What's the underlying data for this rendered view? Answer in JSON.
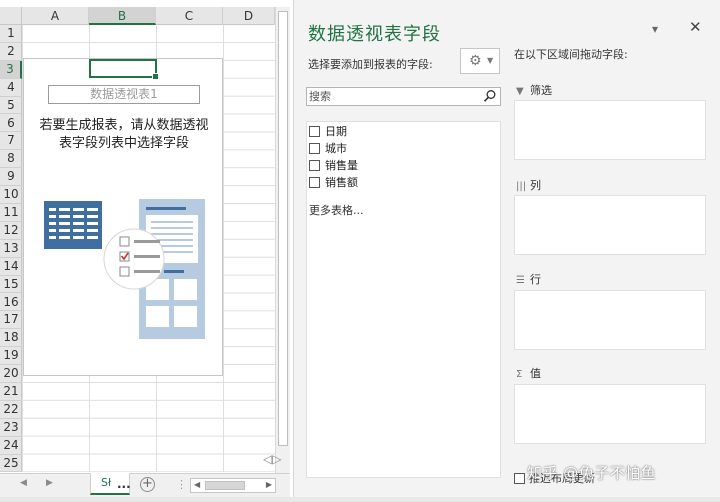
{
  "spreadsheet": {
    "columns": [
      "A",
      "B",
      "C",
      "D"
    ],
    "active_column": "B",
    "rows": [
      "1",
      "2",
      "3",
      "4",
      "5",
      "6",
      "7",
      "8",
      "9",
      "10",
      "11",
      "12",
      "13",
      "14",
      "15",
      "16",
      "17",
      "18",
      "19",
      "20",
      "21",
      "22",
      "23",
      "24",
      "25"
    ],
    "active_row": "3",
    "pivot_placeholder": {
      "name": "数据透视表1",
      "hint_line1": "若要生成报表，请从数据透视",
      "hint_line2": "表字段列表中选择字段"
    },
    "sheet_tab": "Sł",
    "more_sheets": "...",
    "add_sheet": "⊕"
  },
  "pivot_pane": {
    "title": "数据透视表字段",
    "dropdown_glyph": "▾",
    "close_glyph": "✕",
    "choose_label": "选择要添加到报表的字段:",
    "search_placeholder": "搜索",
    "fields": [
      {
        "label": "日期",
        "checked": false
      },
      {
        "label": "城市",
        "checked": false
      },
      {
        "label": "销售量",
        "checked": false
      },
      {
        "label": "销售额",
        "checked": false
      }
    ],
    "more_tables": "更多表格...",
    "drag_label": "在以下区域间拖动字段:",
    "areas": [
      {
        "icon": "filter-icon",
        "label": "筛选"
      },
      {
        "icon": "columns-icon",
        "label": "列"
      },
      {
        "icon": "rows-icon",
        "label": "行"
      },
      {
        "icon": "sigma-icon",
        "label": "值"
      }
    ],
    "defer_update": "推迟布局更新"
  },
  "watermark": "知乎 @兔子不怕鱼",
  "colors": {
    "accent": "#217346",
    "pane_bg": "#f3f3f3",
    "illustration_blue": "#3f6ea0",
    "illustration_light": "#b7cbe0"
  }
}
